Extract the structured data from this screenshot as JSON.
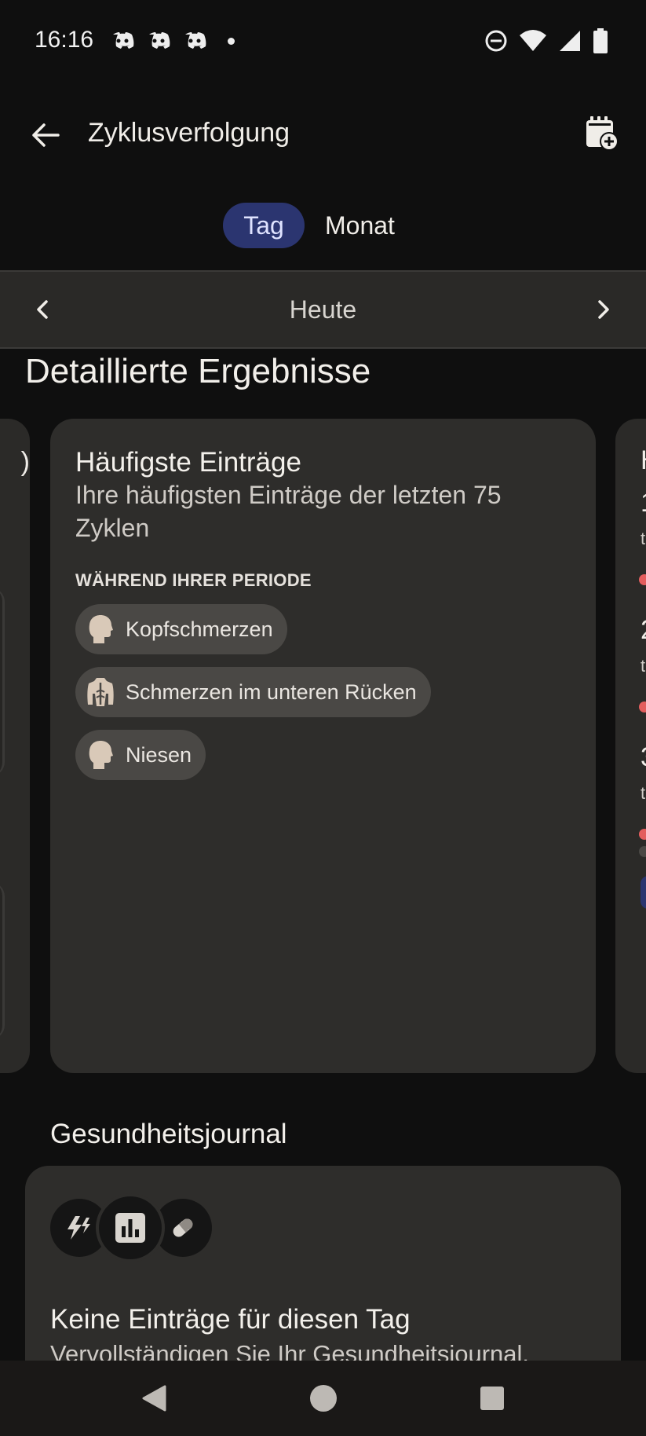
{
  "status_bar": {
    "time": "16:16",
    "notification_icons": [
      "discord-icon",
      "discord-icon",
      "discord-icon"
    ],
    "system_icons": [
      "do-not-disturb-icon",
      "wifi-icon",
      "signal-icon",
      "battery-icon"
    ]
  },
  "app_bar": {
    "title": "Zyklusverfolgung"
  },
  "view_toggle": {
    "options": [
      "Tag",
      "Monat"
    ],
    "selected": "Tag"
  },
  "date_nav": {
    "label": "Heute"
  },
  "detailed_results": {
    "title": "Detaillierte Ergebnisse",
    "main_card": {
      "title": "Häufigste Einträge",
      "subtitle": "Ihre häufigsten Einträge der letzten 75 Zyklen",
      "caption": "WÄHREND IHRER PERIODE",
      "chips": [
        {
          "label": "Kopfschmerzen",
          "icon": "head-icon"
        },
        {
          "label": "Schmerzen im unteren Rücken",
          "icon": "back-icon"
        },
        {
          "label": "Niesen",
          "icon": "head-icon"
        }
      ]
    },
    "left_card": {
      "visible_glyph": ")"
    },
    "right_card": {
      "items": [
        {
          "title": "1",
          "sub": "t"
        },
        {
          "title": "2",
          "sub": "t"
        },
        {
          "title": "3",
          "sub": "t"
        }
      ]
    }
  },
  "journal": {
    "title": "Gesundheitsjournal",
    "empty_title": "Keine Einträge für diesen Tag",
    "hint": "Vervollständigen Sie Ihr Gesundheitsjournal.",
    "icons": [
      "bolt-icon",
      "chart-icon",
      "pill-icon"
    ]
  },
  "colors": {
    "background": "#0f0f0f",
    "card": "#2e2d2b",
    "accent": "#2b3570",
    "chip": "#4a4845",
    "dot_red": "#e35d5d"
  }
}
